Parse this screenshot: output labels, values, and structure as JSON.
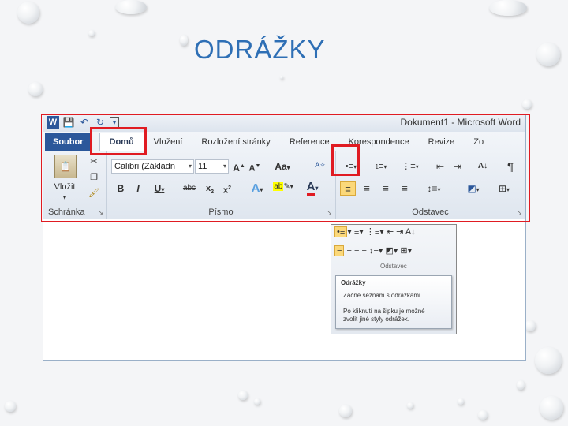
{
  "slide": {
    "title": "ODRÁŽKY"
  },
  "window": {
    "title": "Dokument1 - Microsoft Word",
    "logo": "W"
  },
  "tabs": [
    {
      "label": "Soubor"
    },
    {
      "label": "Domů"
    },
    {
      "label": "Vložení"
    },
    {
      "label": "Rozložení stránky"
    },
    {
      "label": "Reference"
    },
    {
      "label": "Korespondence"
    },
    {
      "label": "Revize"
    },
    {
      "label": "Zo"
    }
  ],
  "clipboard": {
    "label": "Schránka",
    "paste_label": "Vložit"
  },
  "font": {
    "label": "Písmo",
    "font_name": "Calibri (Základn",
    "font_size": "11"
  },
  "paragraph": {
    "label": "Odstavec"
  },
  "submenu": {
    "group_label": "Odstavec"
  },
  "tooltip": {
    "title": "Odrážky",
    "line1": "Začne seznam s odrážkami.",
    "line2": "Po kliknutí na šipku je možné",
    "line3": "zvolit jiné styly odrážek."
  },
  "colors": {
    "accent": "#2b579a",
    "highlight": "#e01b22",
    "title": "#2e6fb5"
  }
}
